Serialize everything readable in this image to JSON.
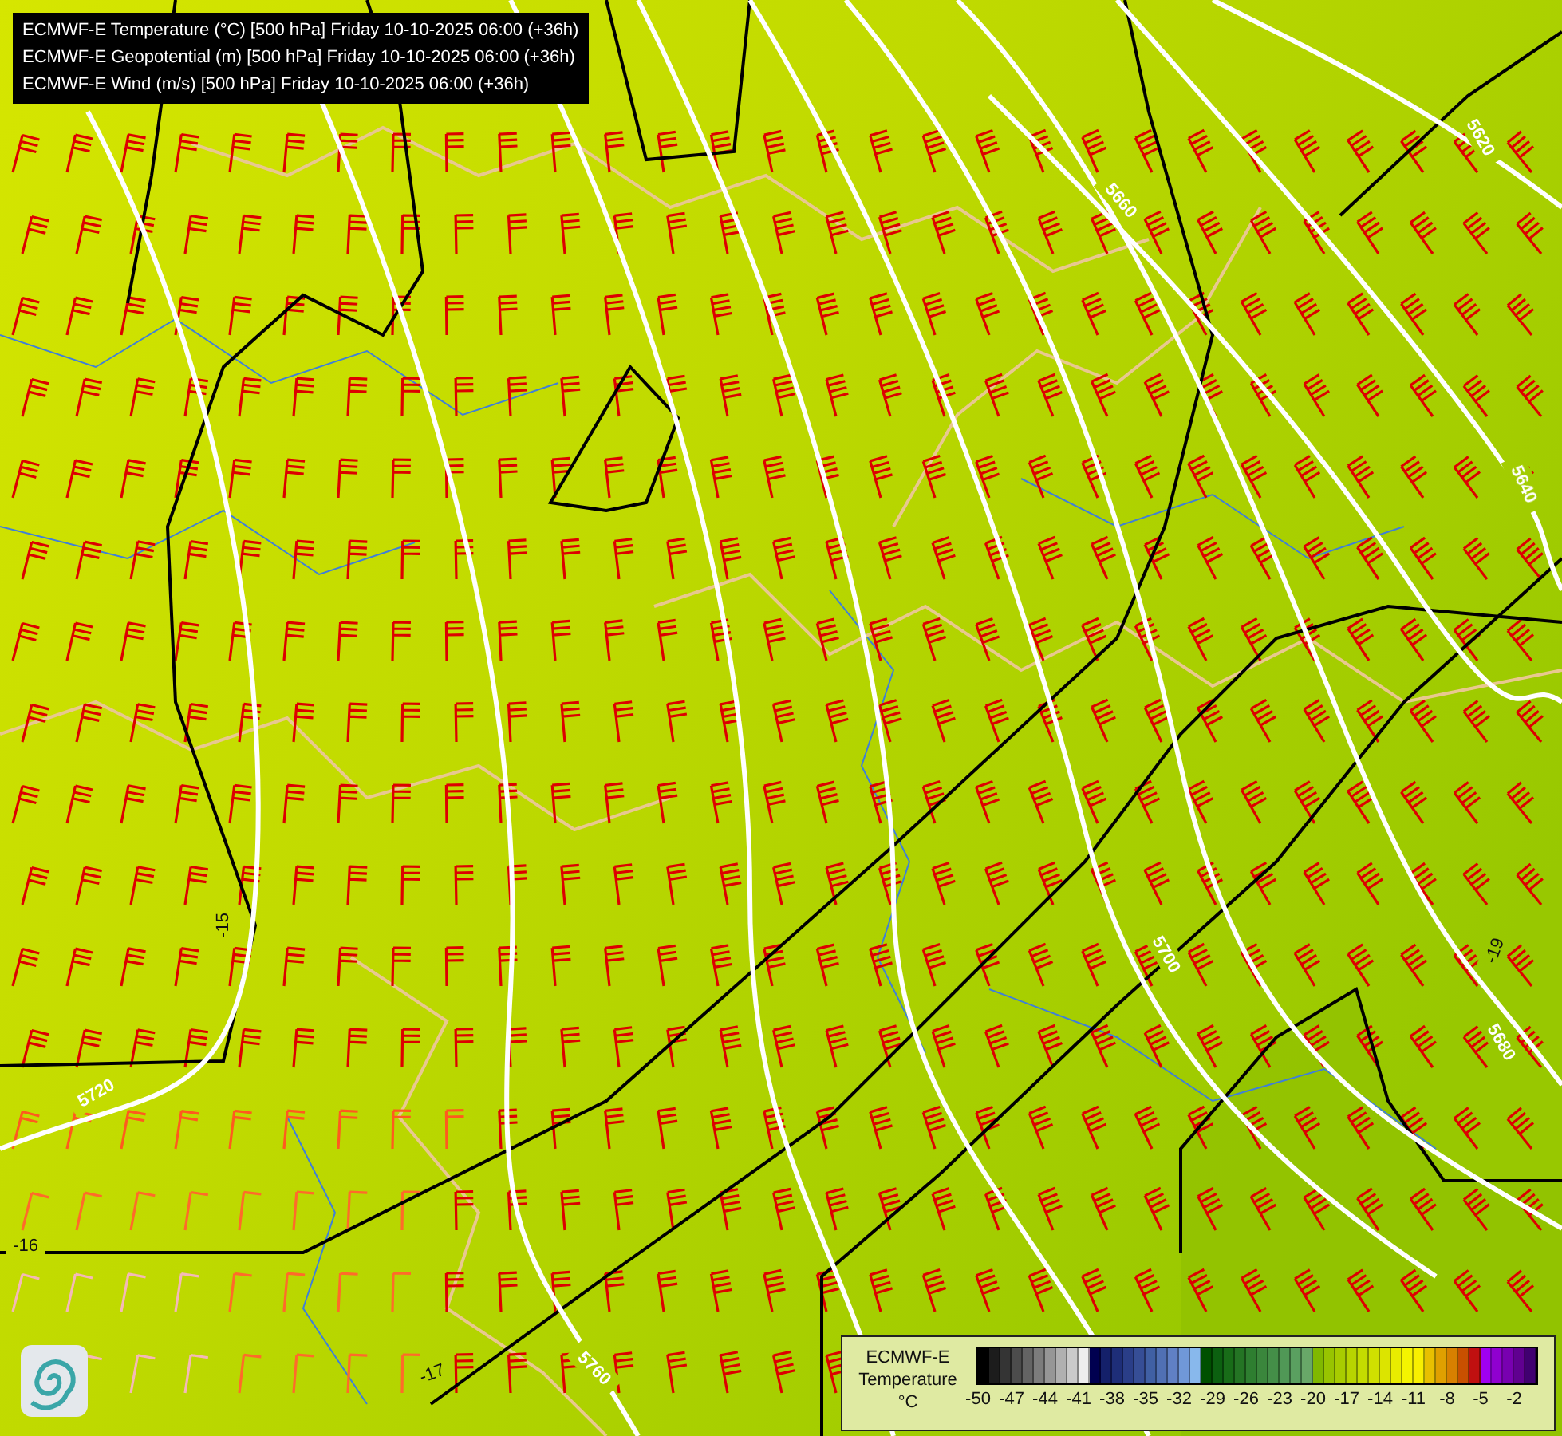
{
  "header": {
    "lines": [
      "ECMWF-E Temperature (°C) [500 hPa] Friday 10-10-2025 06:00 (+36h)",
      "ECMWF-E Geopotential (m) [500 hPa] Friday 10-10-2025 06:00 (+36h)",
      "ECMWF-E Wind (m/s) [500 hPa] Friday 10-10-2025 06:00 (+36h)"
    ]
  },
  "map": {
    "geopotential_labels": [
      "5620",
      "5660",
      "5640",
      "5700",
      "5680",
      "5720",
      "5760"
    ],
    "temperature_labels": [
      "-15",
      "-16",
      "-17",
      "-19"
    ]
  },
  "legend": {
    "title": "ECMWF-E",
    "subtitle": "Temperature",
    "unit": "°C",
    "swatches": [
      {
        "color": "#000000"
      },
      {
        "color": "#1c1c1c"
      },
      {
        "color": "#343434"
      },
      {
        "color": "#4c4c4c"
      },
      {
        "color": "#646464"
      },
      {
        "color": "#7c7c7c"
      },
      {
        "color": "#969696"
      },
      {
        "color": "#b0b0b0"
      },
      {
        "color": "#cacaca"
      },
      {
        "color": "#eeeeee"
      },
      {
        "color": "#000050"
      },
      {
        "color": "#14206a"
      },
      {
        "color": "#1e2e78"
      },
      {
        "color": "#2a3e88"
      },
      {
        "color": "#364e96"
      },
      {
        "color": "#4060a4"
      },
      {
        "color": "#5070b4"
      },
      {
        "color": "#6080c4"
      },
      {
        "color": "#7098d8"
      },
      {
        "color": "#88b8ec"
      },
      {
        "color": "#005000"
      },
      {
        "color": "#0c6010"
      },
      {
        "color": "#186c18"
      },
      {
        "color": "#247424"
      },
      {
        "color": "#2e7e30"
      },
      {
        "color": "#3a863c"
      },
      {
        "color": "#448e48"
      },
      {
        "color": "#509856"
      },
      {
        "color": "#5aa060"
      },
      {
        "color": "#68a868"
      },
      {
        "color": "#80b800"
      },
      {
        "color": "#98c400"
      },
      {
        "color": "#a8cc00"
      },
      {
        "color": "#b8d400"
      },
      {
        "color": "#c4dc00"
      },
      {
        "color": "#d0e000"
      },
      {
        "color": "#dce400"
      },
      {
        "color": "#e8ec00"
      },
      {
        "color": "#f4f400"
      },
      {
        "color": "#f8f000"
      },
      {
        "color": "#e8c000"
      },
      {
        "color": "#e0a000"
      },
      {
        "color": "#d88000"
      },
      {
        "color": "#c85000"
      },
      {
        "color": "#c01010"
      },
      {
        "color": "#a000f0"
      },
      {
        "color": "#9000d0"
      },
      {
        "color": "#7800b0"
      },
      {
        "color": "#600090"
      },
      {
        "color": "#400070"
      }
    ],
    "ticks": [
      "-50",
      "-47",
      "-44",
      "-41",
      "-38",
      "-35",
      "-32",
      "-29",
      "-26",
      "-23",
      "-20",
      "-17",
      "-14",
      "-11",
      "-8",
      "-5",
      "-2"
    ]
  }
}
